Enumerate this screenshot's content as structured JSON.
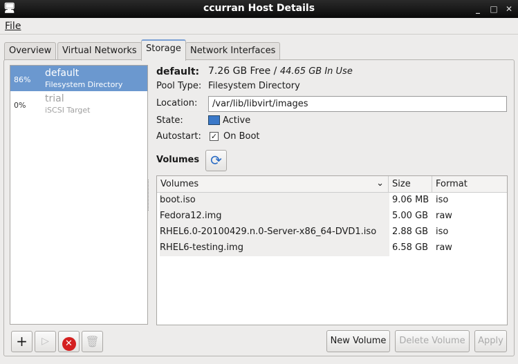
{
  "window": {
    "title": "ccurran Host Details",
    "icon": "monitor-icon"
  },
  "menu": {
    "file": "File"
  },
  "tabs": [
    {
      "label": "Overview"
    },
    {
      "label": "Virtual Networks"
    },
    {
      "label": "Storage"
    },
    {
      "label": "Network Interfaces"
    }
  ],
  "pools": [
    {
      "percent": "86%",
      "name": "default",
      "type": "Filesystem Directory",
      "selected": true
    },
    {
      "percent": "0%",
      "name": "trial",
      "type": "iSCSI Target",
      "selected": false
    }
  ],
  "details": {
    "name": "default:",
    "free": "7.26 GB Free",
    "sep": " / ",
    "in_use": "44.65 GB In Use",
    "pool_type_label": "Pool Type:",
    "pool_type": "Filesystem Directory",
    "location_label": "Location:",
    "location": "/var/lib/libvirt/images",
    "state_label": "State:",
    "state": "Active",
    "autostart_label": "Autostart:",
    "autostart": "On Boot",
    "autostart_checked": true
  },
  "volumes": {
    "title": "Volumes",
    "columns": [
      "Volumes",
      "Size",
      "Format"
    ],
    "rows": [
      [
        "boot.iso",
        "9.06 MB",
        "iso"
      ],
      [
        "Fedora12.img",
        "5.00 GB",
        "raw"
      ],
      [
        "RHEL6.0-20100429.n.0-Server-x86_64-DVD1.iso",
        "2.88 GB",
        "iso"
      ],
      [
        "RHEL6-testing.img",
        "6.58 GB",
        "raw"
      ]
    ]
  },
  "buttons": {
    "new_volume": "New Volume",
    "delete_volume": "Delete Volume",
    "apply": "Apply"
  }
}
